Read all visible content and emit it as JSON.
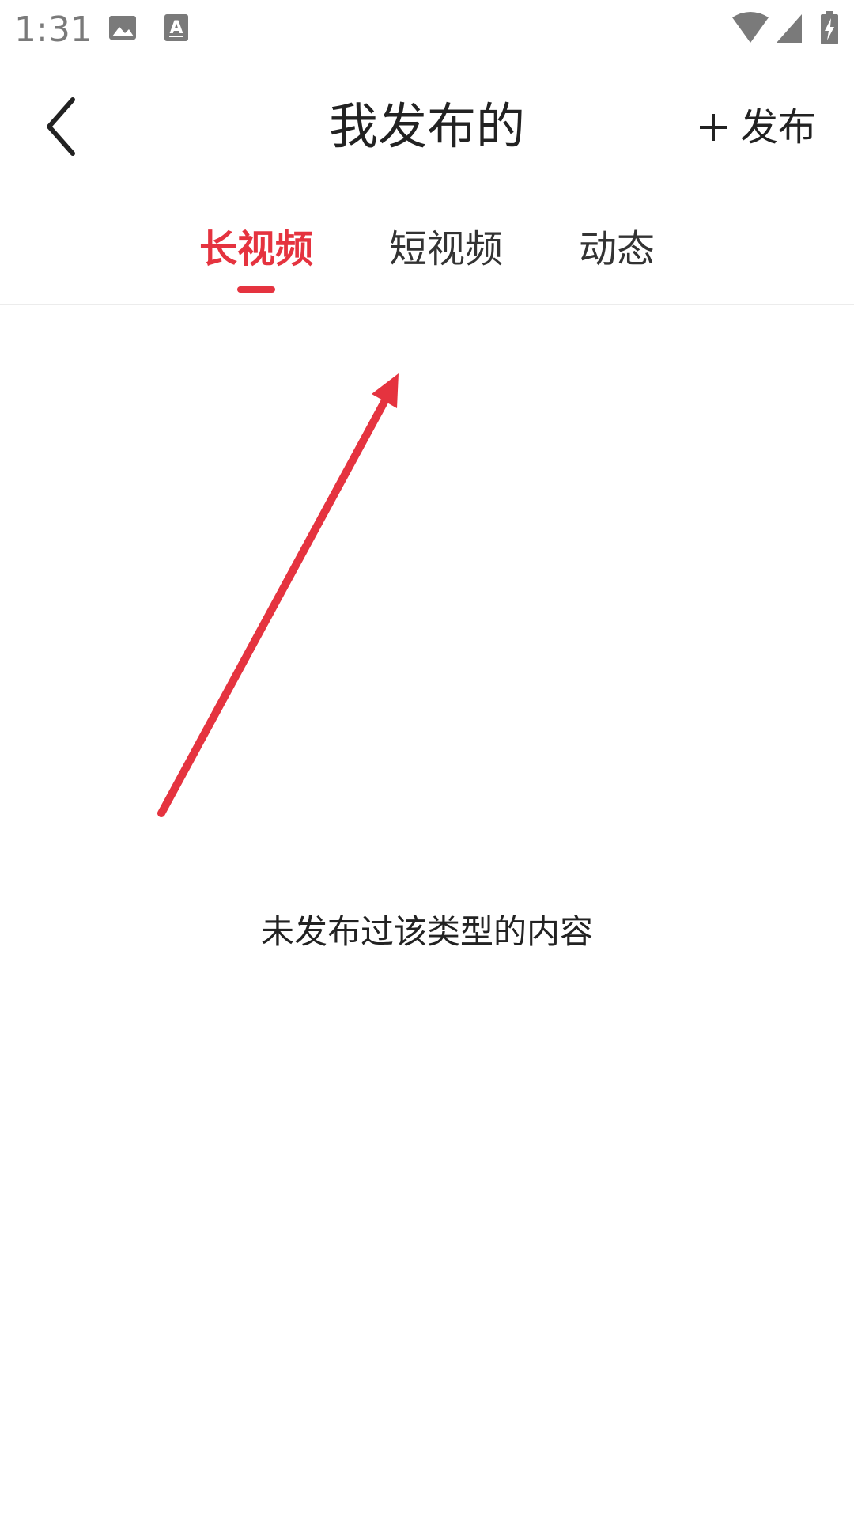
{
  "status_bar": {
    "time": "1:31",
    "icons_left": [
      "image-icon",
      "text-a-icon"
    ],
    "icons_right": [
      "wifi-icon",
      "cellular-signal-icon",
      "battery-charging-icon"
    ]
  },
  "toolbar": {
    "title": "我发布的",
    "back_icon": "chevron-left-icon",
    "publish_label": "发布",
    "publish_icon": "plus-icon"
  },
  "tabs": [
    {
      "label": "长视频",
      "active": true
    },
    {
      "label": "短视频",
      "active": false
    },
    {
      "label": "动态",
      "active": false
    }
  ],
  "content": {
    "empty_message": "未发布过该类型的内容"
  },
  "colors": {
    "accent": "#e5333f",
    "text_primary": "#222222",
    "status_gray": "#7a7a7a",
    "divider": "#ececec",
    "background": "#ffffff"
  }
}
